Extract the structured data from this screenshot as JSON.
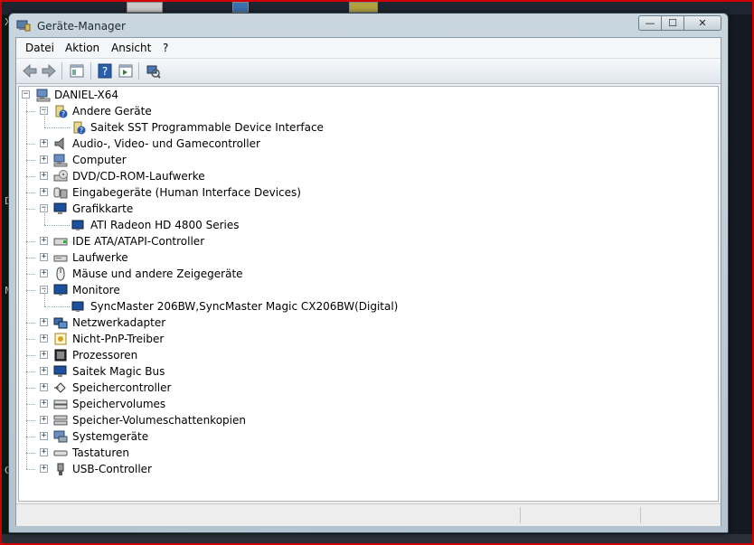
{
  "window": {
    "title": "Geräte-Manager",
    "controls": {
      "minimize": "—",
      "maximize": "☐",
      "close": "✕"
    }
  },
  "menu": [
    "Datei",
    "Aktion",
    "Ansicht",
    "?"
  ],
  "toolbar": [
    "back-icon",
    "forward-icon",
    "show-hide-console-tree-icon",
    "help-icon",
    "show-action-pane-icon",
    "scan-hardware-icon"
  ],
  "tree": {
    "root": "DANIEL-X64",
    "items": [
      {
        "label": "Andere Geräte",
        "expanded": true,
        "children": [
          "Saitek SST Programmable Device Interface"
        ]
      },
      {
        "label": "Audio-, Video- und Gamecontroller"
      },
      {
        "label": "Computer"
      },
      {
        "label": "DVD/CD-ROM-Laufwerke"
      },
      {
        "label": "Eingabegeräte (Human Interface Devices)"
      },
      {
        "label": "Grafikkarte",
        "expanded": true,
        "children": [
          "ATI Radeon HD 4800 Series"
        ]
      },
      {
        "label": "IDE ATA/ATAPI-Controller"
      },
      {
        "label": "Laufwerke"
      },
      {
        "label": "Mäuse und andere Zeigegeräte"
      },
      {
        "label": "Monitore",
        "expanded": true,
        "children": [
          "SyncMaster 206BW,SyncMaster Magic CX206BW(Digital)"
        ]
      },
      {
        "label": "Netzwerkadapter"
      },
      {
        "label": "Nicht-PnP-Treiber"
      },
      {
        "label": "Prozessoren"
      },
      {
        "label": "Saitek Magic Bus"
      },
      {
        "label": "Speichercontroller"
      },
      {
        "label": "Speichervolumes"
      },
      {
        "label": "Speicher-Volumeschattenkopien"
      },
      {
        "label": "Systemgeräte"
      },
      {
        "label": "Tastaturen"
      },
      {
        "label": "USB-Controller"
      }
    ]
  },
  "desktop_glyphs": [
    "X",
    "D",
    "M",
    "O"
  ]
}
